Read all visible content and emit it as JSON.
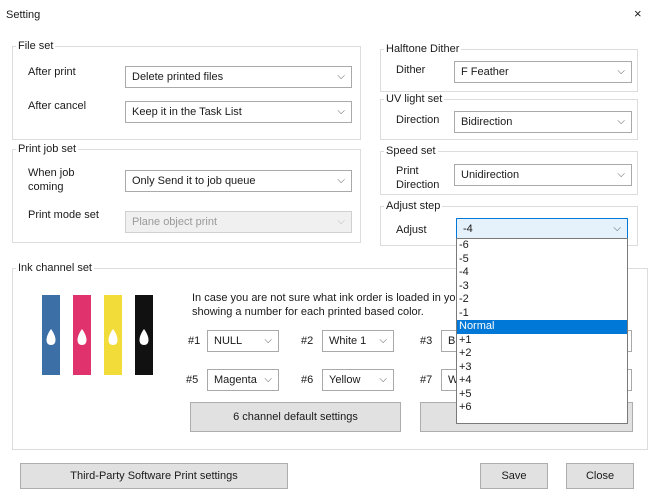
{
  "window": {
    "title": "Setting",
    "close_glyph": "×"
  },
  "file_set": {
    "legend": "File set",
    "after_print": {
      "label": "After print",
      "value": "Delete printed files"
    },
    "after_cancel": {
      "label": "After cancel",
      "value": "Keep it in the Task List"
    }
  },
  "print_job_set": {
    "legend": "Print job set",
    "when_job_coming": {
      "label": "When job coming",
      "value": "Only Send it to job queue"
    },
    "print_mode_set": {
      "label": "Print mode set",
      "value": "Plane object print"
    }
  },
  "halftone_dither": {
    "legend": "Halftone Dither",
    "label": "Dither",
    "value": "F Feather"
  },
  "uv_light_set": {
    "legend": "UV light set",
    "label": "Direction",
    "value": "Bidirection"
  },
  "speed_set": {
    "legend": "Speed set",
    "label": "Print Direction",
    "value": "Unidirection"
  },
  "adjust_step": {
    "legend": "Adjust step",
    "label": "Adjust",
    "value": "-4",
    "options": [
      "-6",
      "-5",
      "-4",
      "-3",
      "-2",
      "-1",
      "Normal",
      "+1",
      "+2",
      "+3",
      "+4",
      "+5",
      "+6"
    ],
    "highlighted": "Normal"
  },
  "ink_channel_set": {
    "legend": "Ink channel set",
    "note_line1": "In case you are not sure what ink order is loaded in yo",
    "note_line2": "showing a number for each printed based color.",
    "ink_colors": [
      "#3d6fa7",
      "#e0336d",
      "#f2dc3a",
      "#111111"
    ],
    "channels": [
      {
        "num": "#1",
        "value": "NULL"
      },
      {
        "num": "#2",
        "value": "White 1"
      },
      {
        "num": "#3",
        "value": "Bla"
      },
      {
        "num": "#5",
        "value": "Magenta"
      },
      {
        "num": "#6",
        "value": "Yellow"
      },
      {
        "num": "#7",
        "value": "Wh"
      }
    ],
    "default_button": "6 channel default settings"
  },
  "footer": {
    "third_party_button": "Third-Party Software Print settings",
    "save_button": "Save",
    "close_button": "Close"
  }
}
